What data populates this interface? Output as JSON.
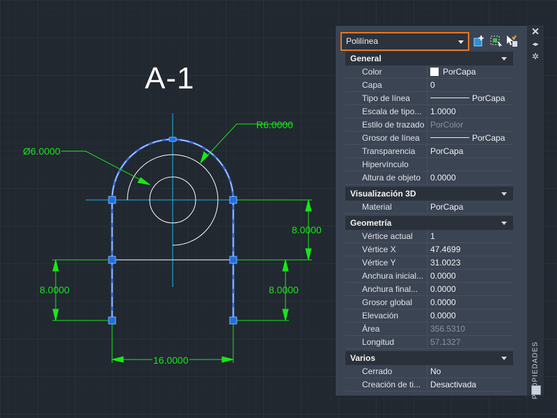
{
  "drawing": {
    "title": "A-1",
    "dimensions": {
      "diameter": "Ø6.0000",
      "radius": "R6.0000",
      "right_vertical": "8.0000",
      "left_lower_vertical": "8.0000",
      "right_lower_vertical": "8.0000",
      "bottom_horizontal": "16.0000"
    },
    "colors": {
      "background": "#212830",
      "selection": "#3a6fd8",
      "dimension": "#19e619",
      "centerline": "#19b6e6",
      "geometry": "#ffffff"
    }
  },
  "properties": {
    "object_type": "Polilínea",
    "side_label": "PROPIEDADES",
    "accent": "#e87722",
    "sections": [
      {
        "title": "General",
        "rows": [
          {
            "label": "Color",
            "value": "PorCapa",
            "kind": "swatch"
          },
          {
            "label": "Capa",
            "value": "0"
          },
          {
            "label": "Tipo de línea",
            "value": "PorCapa",
            "kind": "linetype"
          },
          {
            "label": "Escala de tipo...",
            "value": "1.0000"
          },
          {
            "label": "Estilo de trazado",
            "value": "PorColor",
            "kind": "dim"
          },
          {
            "label": "Grosor de línea",
            "value": "PorCapa",
            "kind": "linetype"
          },
          {
            "label": "Transparencia",
            "value": "PorCapa"
          },
          {
            "label": "Hipervínculo",
            "value": ""
          },
          {
            "label": "Altura de objeto",
            "value": "0.0000"
          }
        ]
      },
      {
        "title": "Visualización 3D",
        "rows": [
          {
            "label": "Material",
            "value": "PorCapa"
          }
        ]
      },
      {
        "title": "Geometría",
        "rows": [
          {
            "label": "Vértice actual",
            "value": "1"
          },
          {
            "label": "Vértice X",
            "value": "47.4699"
          },
          {
            "label": "Vértice Y",
            "value": "31.0023"
          },
          {
            "label": "Anchura inicial...",
            "value": "0.0000"
          },
          {
            "label": "Anchura final...",
            "value": "0.0000"
          },
          {
            "label": "Grosor global",
            "value": "0.0000"
          },
          {
            "label": "Elevación",
            "value": "0.0000"
          },
          {
            "label": "Área",
            "value": "356.5310",
            "kind": "dim"
          },
          {
            "label": "Longitud",
            "value": "57.1327",
            "kind": "dim"
          }
        ]
      },
      {
        "title": "Varios",
        "rows": [
          {
            "label": "Cerrado",
            "value": "No"
          },
          {
            "label": "Creación de ti...",
            "value": "Desactivada"
          }
        ]
      }
    ]
  }
}
